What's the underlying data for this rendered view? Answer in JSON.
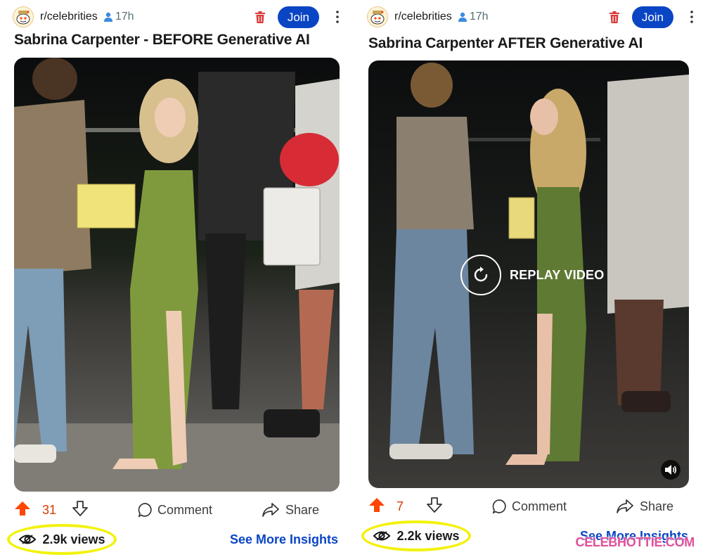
{
  "posts": [
    {
      "subreddit": "r/celebrities",
      "age": "17h",
      "join_label": "Join",
      "title": "Sabrina Carpenter - BEFORE Generative AI",
      "votes": "31",
      "comment_label": "Comment",
      "share_label": "Share",
      "views": "2.9k views",
      "insights_label": "See More Insights"
    },
    {
      "subreddit": "r/celebrities",
      "age": "17h",
      "join_label": "Join",
      "title": "Sabrina Carpenter AFTER Generative AI",
      "votes": "7",
      "comment_label": "Comment",
      "share_label": "Share",
      "views": "2.2k views",
      "insights_label": "See More Insights",
      "replay_label": "REPLAY VIDEO"
    }
  ],
  "watermark": "CELEBHOTTIE.COM",
  "colors": {
    "join": "#0a45c4",
    "upvote": "#ff4500",
    "vote_count": "#d93a00",
    "highlight": "#f2f20e",
    "insights": "#0a45c4",
    "trash": "#d93a3a",
    "watermark": "#e24f9a"
  },
  "icons": {
    "avatar": "snoo-icon",
    "members": "person-icon",
    "delete": "trash-icon",
    "menu": "kebab-icon",
    "upvote": "upvote-arrow-icon",
    "downvote": "downvote-arrow-icon",
    "comment": "speech-bubble-icon",
    "share": "share-arrow-icon",
    "views": "eye-icon",
    "replay": "replay-icon",
    "volume": "speaker-icon"
  }
}
